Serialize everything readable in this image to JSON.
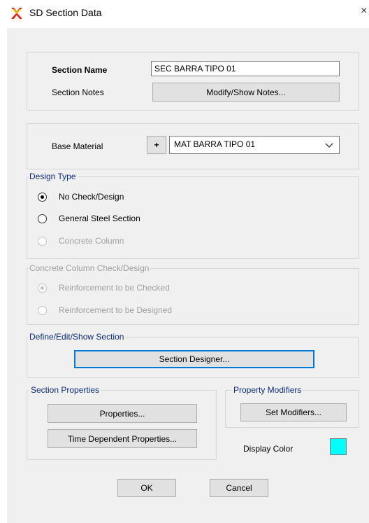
{
  "window": {
    "title": "SD Section Data",
    "close_glyph": "×"
  },
  "section": {
    "name_label": "Section Name",
    "name_value": "SEC BARRA TIPO 01",
    "notes_label": "Section Notes",
    "notes_button": "Modify/Show Notes..."
  },
  "material": {
    "label": "Base Material",
    "add_button": "+",
    "selected": "MAT BARRA TIPO 01"
  },
  "design_type": {
    "title": "Design Type",
    "options": [
      {
        "label": "No Check/Design",
        "checked": true,
        "enabled": true
      },
      {
        "label": "General Steel Section",
        "checked": false,
        "enabled": true
      },
      {
        "label": "Concrete Column",
        "checked": false,
        "enabled": false
      }
    ]
  },
  "concrete_column": {
    "title": "Concrete Column Check/Design",
    "options": [
      {
        "label": "Reinforcement to be Checked",
        "checked": true,
        "enabled": false
      },
      {
        "label": "Reinforcement to be Designed",
        "checked": false,
        "enabled": false
      }
    ]
  },
  "define_section": {
    "title": "Define/Edit/Show Section",
    "button": "Section Designer..."
  },
  "section_properties": {
    "title": "Section Properties",
    "properties_button": "Properties...",
    "time_button": "Time Dependent Properties..."
  },
  "property_modifiers": {
    "title": "Property Modifiers",
    "button": "Set Modifiers..."
  },
  "display_color": {
    "label": "Display Color",
    "color": "#00ffff"
  },
  "footer": {
    "ok": "OK",
    "cancel": "Cancel"
  },
  "icons": {
    "app": "sap-x-icon",
    "combo": "chevron-down-icon"
  }
}
